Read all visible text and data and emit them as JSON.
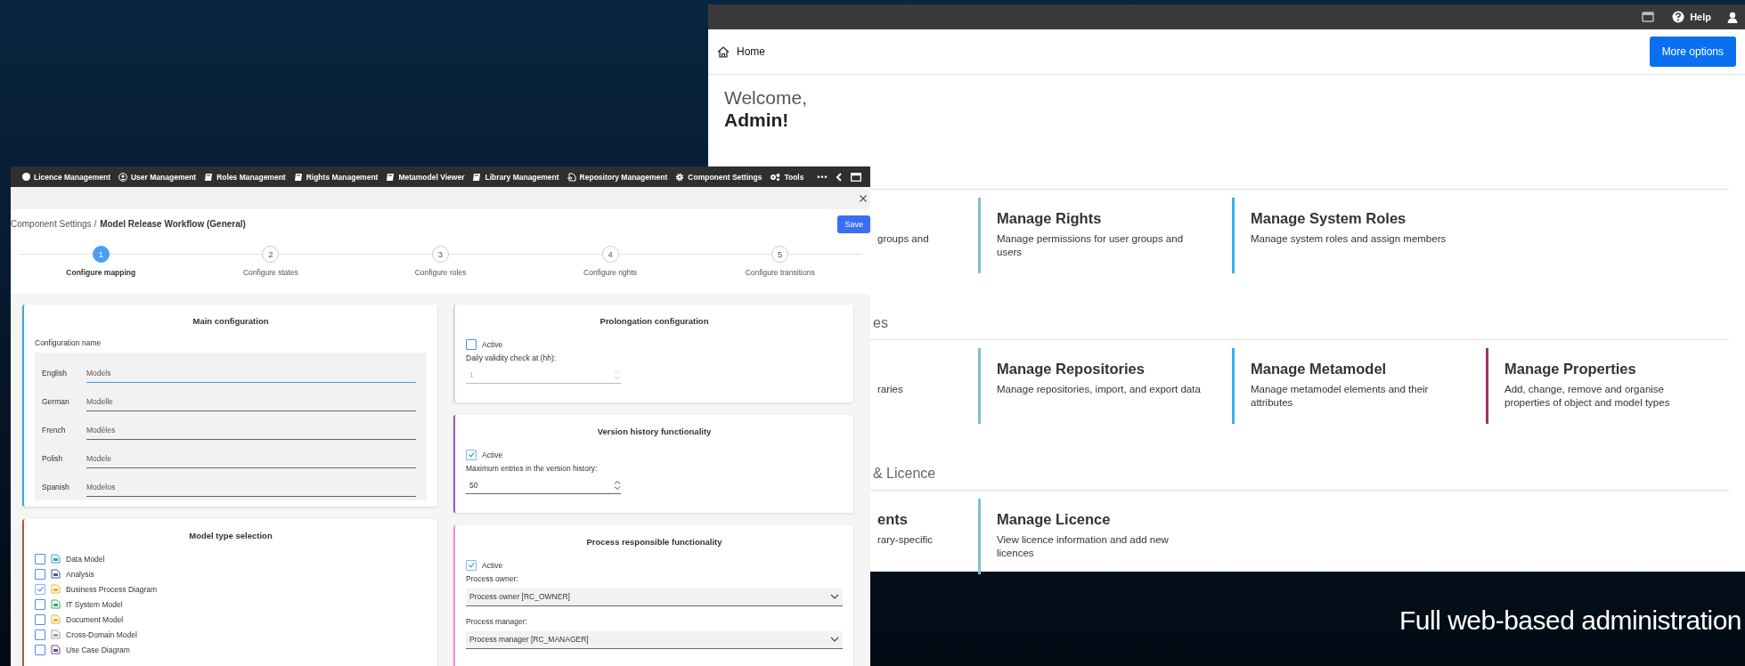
{
  "back_window": {
    "top_bar": {
      "help_label": "Help"
    },
    "breadcrumb": "Home",
    "more_options_button": "More options",
    "greeting": "Welcome,",
    "user_name": "Admin!",
    "sections": [
      {
        "cards": [
          {
            "description": "groups and"
          },
          {
            "title": "Manage Rights",
            "description": "Manage permissions for user groups and users",
            "color": "#7fbfd0"
          },
          {
            "title": "Manage System Roles",
            "description": "Manage system roles and assign members",
            "color": "#3ab0e8"
          }
        ]
      },
      {
        "heading": "es",
        "cards": [
          {
            "description": "raries"
          },
          {
            "title": "Manage Repositories",
            "description": "Manage repositories, import, and export data",
            "color": "#7fbfd0"
          },
          {
            "title": "Manage Metamodel",
            "description": "Manage metamodel elements and their attributes",
            "color": "#3ab0e8"
          },
          {
            "title": "Manage Properties",
            "description": "Add, change, remove and organise properties of object and model types",
            "color": "#a0306a"
          }
        ]
      },
      {
        "heading": "& Licence",
        "cards": [
          {
            "title": "ents",
            "description": "rary-specific"
          },
          {
            "title": "Manage Licence",
            "description": "View licence information and add new licences",
            "color": "#7fbfd0"
          }
        ]
      }
    ]
  },
  "front_window": {
    "toolbar": [
      {
        "kind": "dot",
        "label": "Licence Management"
      },
      {
        "kind": "user",
        "label": "User Management"
      },
      {
        "kind": "book",
        "label": "Roles Management"
      },
      {
        "kind": "book",
        "label": "Rights Management"
      },
      {
        "kind": "book",
        "label": "Metamodel Viewer"
      },
      {
        "kind": "book",
        "label": "Library Management"
      },
      {
        "kind": "import",
        "label": "Repository Management"
      },
      {
        "kind": "gear",
        "label": "Component Settings"
      },
      {
        "kind": "gears",
        "label": "Tools"
      }
    ],
    "toolbar_overflow": "•••",
    "breadcrumb_parent": "Component Settings /",
    "breadcrumb_current": "Model Release Workflow (General)",
    "save_button": "Save",
    "steps": [
      {
        "number": "1",
        "label": "Configure mapping",
        "selected": true
      },
      {
        "number": "2",
        "label": "Configure states",
        "selected": false
      },
      {
        "number": "3",
        "label": "Configure roles",
        "selected": false
      },
      {
        "number": "4",
        "label": "Configure rights",
        "selected": false
      },
      {
        "number": "5",
        "label": "Configure transitions",
        "selected": false
      }
    ],
    "main_configuration": {
      "title": "Main configuration",
      "name_label": "Configuration name",
      "fields": [
        {
          "language": "English",
          "value": "Models",
          "focused": true
        },
        {
          "language": "German",
          "value": "Modelle",
          "focused": false
        },
        {
          "language": "French",
          "value": "Modèles",
          "focused": false
        },
        {
          "language": "Polish",
          "value": "Modele",
          "focused": false
        },
        {
          "language": "Spanish",
          "value": "Modelos",
          "focused": false
        }
      ]
    },
    "model_type_selection": {
      "title": "Model type selection",
      "items": [
        {
          "label": "Data Model",
          "checked": false,
          "color": "#2aa3c8"
        },
        {
          "label": "Analysis",
          "checked": false,
          "color": "#3a5a9a"
        },
        {
          "label": "Business Process Diagram",
          "checked": true,
          "color": "#f0b020"
        },
        {
          "label": "IT System Model",
          "checked": false,
          "color": "#3aaa70"
        },
        {
          "label": "Document Model",
          "checked": false,
          "color": "#f0b020"
        },
        {
          "label": "Cross-Domain Model",
          "checked": false,
          "color": "#a0a0a0"
        },
        {
          "label": "Use Case Diagram",
          "checked": false,
          "color": "#6a4a8a"
        }
      ]
    },
    "prolongation": {
      "title": "Prolongation configuration",
      "active_label": "Active",
      "active": false,
      "field_label": "Daily validity check at (hh):",
      "value": "1",
      "disabled": true
    },
    "version_history": {
      "title": "Version history functionality",
      "active_label": "Active",
      "active": true,
      "field_label": "Maximum entries in the version history:",
      "value": "50",
      "disabled": false
    },
    "process_responsible": {
      "title": "Process responsible functionality",
      "active_label": "Active",
      "active": true,
      "selects": [
        {
          "label": "Process owner:",
          "value": "Process owner [RC_OWNER]"
        },
        {
          "label": "Process manager:",
          "value": "Process manager [RC_MANAGER]"
        }
      ]
    }
  },
  "caption": "Full web-based administration"
}
